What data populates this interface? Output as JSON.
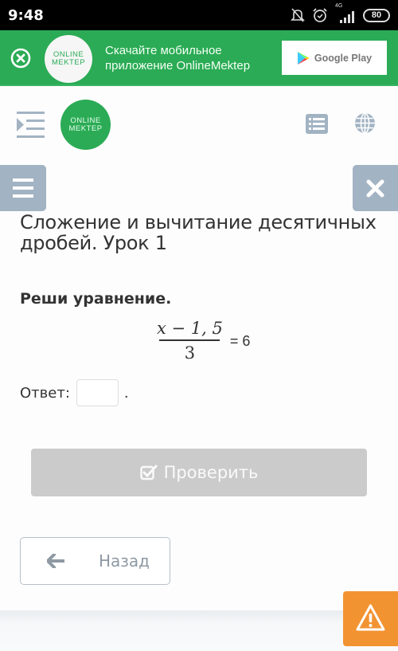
{
  "status_bar": {
    "time": "9:48",
    "network": "4G",
    "battery": "80",
    "icons": [
      "bell-muted-icon",
      "alarm-icon",
      "signal-icon",
      "battery-icon"
    ]
  },
  "promo_banner": {
    "logo_line1": "ONLINE",
    "logo_line2": "MEKTEP",
    "text_line1": "Скачайте мобильное",
    "text_line2": "приложение OnlineMektep",
    "store_button": "Google Play",
    "colors": {
      "background": "#2bab55"
    }
  },
  "header": {
    "logo_line1": "ONLINE",
    "logo_line2": "MEKTEP"
  },
  "lesson": {
    "title": "Сложение и вычитание десятичных дробей. Урок 1"
  },
  "task": {
    "title": "Реши уравнение.",
    "equation": {
      "numerator": "x − 1, 5",
      "denominator": "3",
      "rhs": "= 6"
    },
    "answer_label": "Ответ:",
    "answer_value": "",
    "answer_suffix": "."
  },
  "buttons": {
    "check": "Проверить",
    "back": "Назад"
  },
  "colors": {
    "accent": "#2bab55",
    "side_buttons": "#a2b3c3",
    "check_disabled": "#cbcbcb",
    "report": "#f29331"
  }
}
